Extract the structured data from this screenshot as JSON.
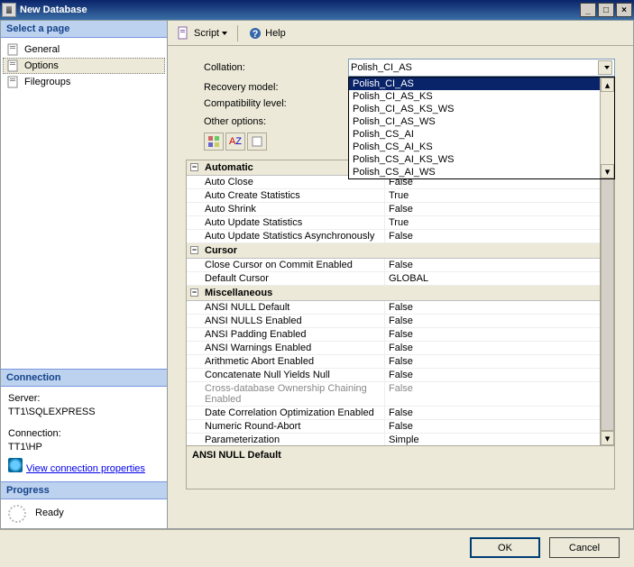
{
  "window": {
    "title": "New Database"
  },
  "left": {
    "selectHeader": "Select a page",
    "pages": [
      "General",
      "Options",
      "Filegroups"
    ],
    "connection": {
      "header": "Connection",
      "serverLabel": "Server:",
      "serverValue": "TT1\\SQLEXPRESS",
      "connLabel": "Connection:",
      "connValue": "TT1\\HP",
      "viewProps": "View connection properties"
    },
    "progress": {
      "header": "Progress",
      "status": "Ready"
    }
  },
  "toolbar": {
    "script": "Script",
    "help": "Help"
  },
  "form": {
    "collationLabel": "Collation:",
    "collationValue": "Polish_CI_AS",
    "recoveryLabel": "Recovery model:",
    "compatLabel": "Compatibility level:",
    "otherLabel": "Other options:"
  },
  "dropdownOptions": [
    "Polish_CI_AS",
    "Polish_CI_AS_KS",
    "Polish_CI_AS_KS_WS",
    "Polish_CI_AS_WS",
    "Polish_CS_AI",
    "Polish_CS_AI_KS",
    "Polish_CS_AI_KS_WS",
    "Polish_CS_AI_WS"
  ],
  "grid": {
    "cats": [
      {
        "name": "Automatic",
        "rows": [
          {
            "k": "Auto Close",
            "v": "False"
          },
          {
            "k": "Auto Create Statistics",
            "v": "True"
          },
          {
            "k": "Auto Shrink",
            "v": "False"
          },
          {
            "k": "Auto Update Statistics",
            "v": "True"
          },
          {
            "k": "Auto Update Statistics Asynchronously",
            "v": "False"
          }
        ]
      },
      {
        "name": "Cursor",
        "rows": [
          {
            "k": "Close Cursor on Commit Enabled",
            "v": "False"
          },
          {
            "k": "Default Cursor",
            "v": "GLOBAL"
          }
        ]
      },
      {
        "name": "Miscellaneous",
        "rows": [
          {
            "k": "ANSI NULL Default",
            "v": "False"
          },
          {
            "k": "ANSI NULLS Enabled",
            "v": "False"
          },
          {
            "k": "ANSI Padding Enabled",
            "v": "False"
          },
          {
            "k": "ANSI Warnings Enabled",
            "v": "False"
          },
          {
            "k": "Arithmetic Abort Enabled",
            "v": "False"
          },
          {
            "k": "Concatenate Null Yields Null",
            "v": "False"
          },
          {
            "k": "Cross-database Ownership Chaining Enabled",
            "v": "False",
            "disabled": true
          },
          {
            "k": "Date Correlation Optimization Enabled",
            "v": "False"
          },
          {
            "k": "Numeric Round-Abort",
            "v": "False"
          },
          {
            "k": "Parameterization",
            "v": "Simple"
          }
        ]
      }
    ]
  },
  "descBox": "ANSI NULL Default",
  "footer": {
    "ok": "OK",
    "cancel": "Cancel"
  }
}
